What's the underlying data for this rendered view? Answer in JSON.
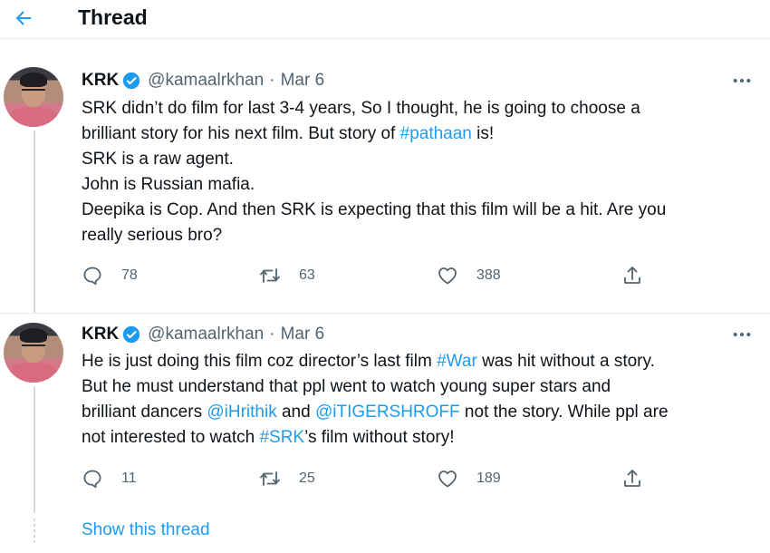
{
  "header": {
    "title": "Thread",
    "back_icon": "arrow-left-icon",
    "accent_color": "#1d9bf0"
  },
  "tweets": [
    {
      "name": "KRK",
      "handle": "@kamaalrkhan",
      "separator": "·",
      "date": "Mar 6",
      "lines": [
        [
          {
            "t": "SRK didn’t do film for last 3-4 years, So I thought, he is going to choose a"
          }
        ],
        [
          {
            "t": "brilliant story for his next film. But story of "
          },
          {
            "t": "#pathaan",
            "link": true
          },
          {
            "t": " is!"
          }
        ],
        [
          {
            "t": "SRK is a raw agent."
          }
        ],
        [
          {
            "t": "John is Russian mafia."
          }
        ],
        [
          {
            "t": "Deepika is Cop. And then SRK is expecting that this film will be a hit. Are you"
          }
        ],
        [
          {
            "t": "really serious bro?"
          }
        ]
      ],
      "replies": "78",
      "retweets": "63",
      "likes": "388"
    },
    {
      "name": "KRK",
      "handle": "@kamaalrkhan",
      "separator": "·",
      "date": "Mar 6",
      "lines": [
        [
          {
            "t": "He is just doing this film coz director’s last film "
          },
          {
            "t": "#War",
            "link": true
          },
          {
            "t": " was hit without a story."
          }
        ],
        [
          {
            "t": "But he must understand that ppl went to watch young super stars and"
          }
        ],
        [
          {
            "t": "brilliant dancers "
          },
          {
            "t": "@iHrithik",
            "link": true
          },
          {
            "t": " and "
          },
          {
            "t": "@iTIGERSHROFF",
            "link": true
          },
          {
            "t": " not the story. While ppl are"
          }
        ],
        [
          {
            "t": "not interested to watch "
          },
          {
            "t": "#SRK",
            "link": true
          },
          {
            "t": "’s film without story!"
          }
        ]
      ],
      "replies": "11",
      "retweets": "25",
      "likes": "189"
    }
  ],
  "show_thread_label": "Show this thread"
}
